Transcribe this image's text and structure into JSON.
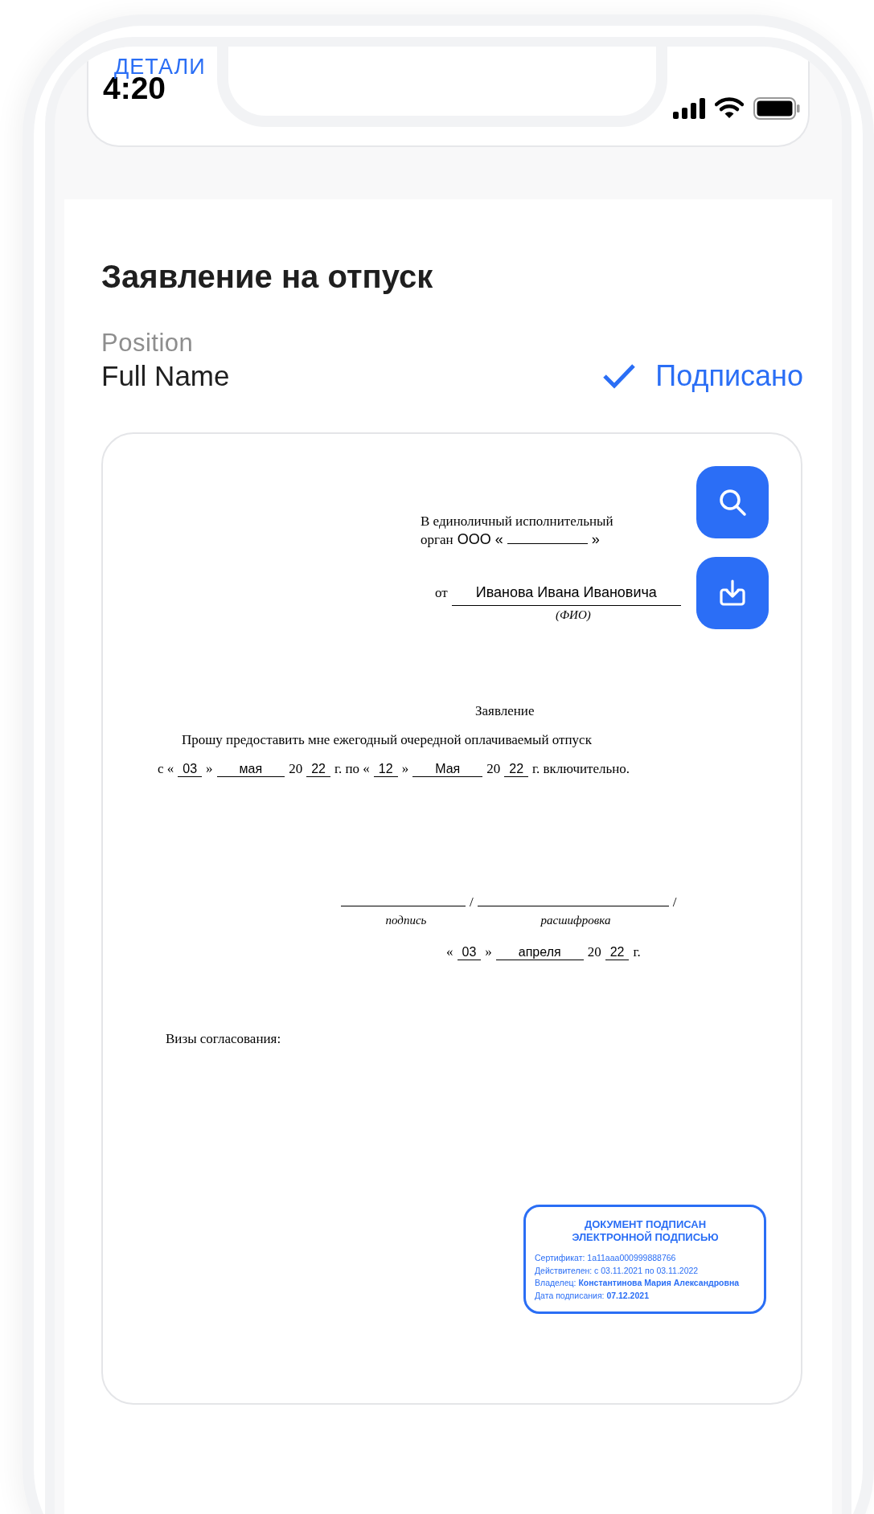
{
  "status_bar": {
    "back_label": "ДЕТАЛИ",
    "time": "4:20"
  },
  "title": "Заявление на отпуск",
  "signer": {
    "position": "Position",
    "name": "Full Name",
    "status": "Подписано",
    "signed": true
  },
  "document": {
    "addressee": [
      [
        {
          "kind": "text",
          "text": "В единоличный исполнительный"
        }
      ],
      [
        {
          "kind": "text",
          "text": "орган"
        },
        {
          "kind": "print",
          "text": "ООО «"
        },
        {
          "kind": "blank_short"
        },
        {
          "kind": "print",
          "text": "»"
        }
      ]
    ],
    "from_line": [
      {
        "kind": "text",
        "text": "от"
      },
      {
        "kind": "name",
        "text": "Иванова Ивана Ивановича"
      }
    ],
    "from_caption": "(ФИО)",
    "heading": "Заявление",
    "request": "Прошу предоставить мне ежегодный очередной оплачиваемый отпуск",
    "period": [
      {
        "kind": "text",
        "text": "с «"
      },
      {
        "kind": "num",
        "text": "03"
      },
      {
        "kind": "text",
        "text": "»"
      },
      {
        "kind": "field",
        "text": "мая"
      },
      {
        "kind": "text",
        "text": "20"
      },
      {
        "kind": "num",
        "text": "22"
      },
      {
        "kind": "text",
        "text": "г. по «"
      },
      {
        "kind": "num",
        "text": "12"
      },
      {
        "kind": "text",
        "text": "»"
      },
      {
        "kind": "field",
        "text": "Мая"
      },
      {
        "kind": "text",
        "text": "20"
      },
      {
        "kind": "num",
        "text": "22"
      },
      {
        "kind": "text",
        "text": "г. включительно."
      }
    ],
    "signature": [
      {
        "kind": "blank"
      },
      {
        "kind": "text",
        "text": "/"
      },
      {
        "kind": "blank_long"
      },
      {
        "kind": "text",
        "text": "/"
      }
    ],
    "signature_captions": [
      "подпись",
      "расшифровка"
    ],
    "signed_date": [
      {
        "kind": "text",
        "text": "«"
      },
      {
        "kind": "num",
        "text": "03"
      },
      {
        "kind": "text",
        "text": "»"
      },
      {
        "kind": "field",
        "text": "апреля"
      },
      {
        "kind": "text",
        "text": "20"
      },
      {
        "kind": "num",
        "text": "22"
      },
      {
        "kind": "text",
        "text": "г."
      }
    ],
    "approvals": "Визы согласования:",
    "stamp": {
      "title_lines": [
        "ДОКУМЕНТ ПОДПИСАН",
        "ЭЛЕКТРОННОЙ ПОДПИСЬЮ"
      ],
      "lines": [
        "Сертификат: 1a11aaa000999888766",
        "Действителен: с 03.11.2021 по 03.11.2022",
        "Владелец: **Константинова Мария Александровна**",
        "Дата подписания: **07.12.2021**"
      ]
    }
  }
}
